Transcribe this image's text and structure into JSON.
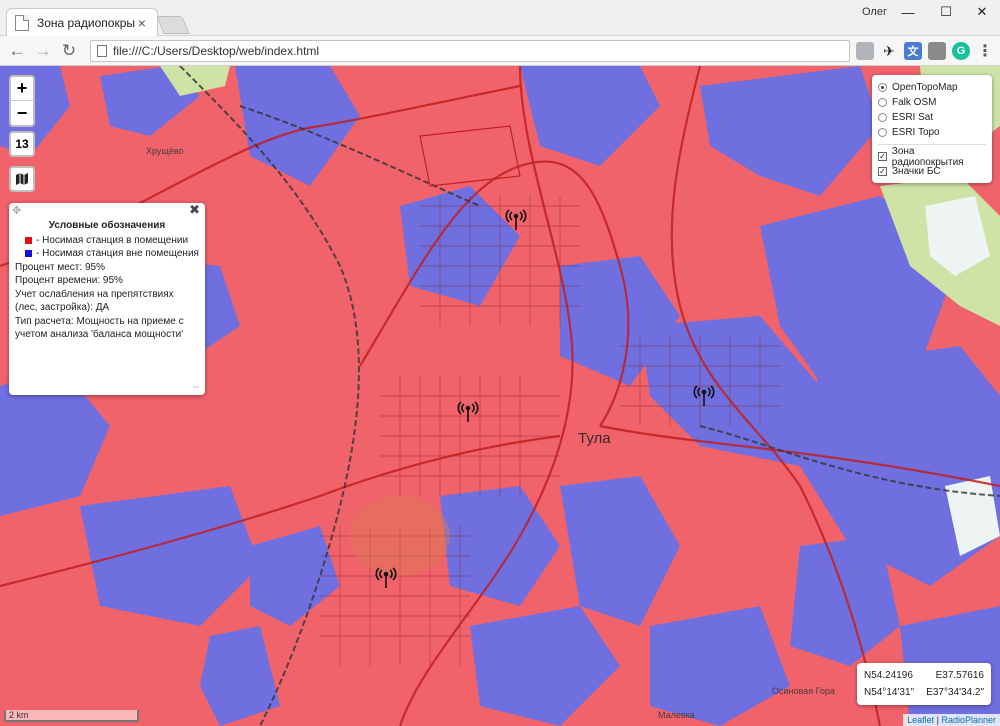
{
  "browser": {
    "tab_title": "Зона радиопокрытия",
    "tab_close": "×",
    "user_name": "Олег",
    "url": "file:///C:/Users/Desktop/web/index.html",
    "window_controls": {
      "minimize": "—",
      "maximize": "☐",
      "close": "✕"
    },
    "nav": {
      "back": "←",
      "forward": "→",
      "reload": "↻"
    },
    "extensions": [
      {
        "icon": "ghost-extension-icon",
        "color": "#9aa0a6",
        "glyph": ""
      },
      {
        "icon": "plane-extension-icon",
        "color": "#222222",
        "glyph": "✈"
      },
      {
        "icon": "translate-extension-icon",
        "color": "#4a7bd0",
        "glyph": "文"
      },
      {
        "icon": "save-extension-icon",
        "color": "#8a8a8a",
        "glyph": ""
      },
      {
        "icon": "grammar-extension-icon",
        "color": "#15c39a",
        "glyph": "G"
      }
    ],
    "menu_icon": "⋮"
  },
  "map": {
    "zoom_in": "+",
    "zoom_out": "−",
    "zoom_level": "13",
    "basemap_icon": "map-icon",
    "city_label": "Тула",
    "place_labels": [
      {
        "text": "Хрущёво"
      },
      {
        "text": "Осиновая Гора"
      },
      {
        "text": "Малевка"
      }
    ],
    "colors": {
      "coverage_indoor": "#ff0000",
      "coverage_outdoor": "#0000ff",
      "map_red": "#f0636b",
      "map_blue": "#6f6fe0"
    }
  },
  "legend": {
    "title": "Условные обозначения",
    "items": [
      {
        "label": "- Носимая станция в помещении",
        "color": "#e01010"
      },
      {
        "label": "- Носимая станция вне помещения",
        "color": "#1010e0"
      }
    ],
    "lines": [
      "Процент мест: 95%",
      "Процент времени: 95%",
      "Учет ослабления на препятствиях",
      "(лес, застройка): ДА",
      "Тип расчета: Мощность на приеме с",
      "учетом анализа 'баланса мощности'"
    ]
  },
  "layers": {
    "base": [
      {
        "label": "OpenTopoMap",
        "checked": true
      },
      {
        "label": "Falk OSM",
        "checked": false
      },
      {
        "label": "ESRI Sat",
        "checked": false
      },
      {
        "label": "ESRI Topo",
        "checked": false
      }
    ],
    "overlays": [
      {
        "label": "Зона радиопокрытия",
        "checked": true
      },
      {
        "label": "Значки БС",
        "checked": true
      }
    ]
  },
  "coords": {
    "lat_dec": "N54.24196",
    "lon_dec": "E37.57616",
    "lat_dms": "N54°14'31\"",
    "lon_dms": "E37°34'34.2\""
  },
  "scale": "2 km",
  "attribution": {
    "leaflet": "Leaflet",
    "sep": " | ",
    "radioplanner": "RadioPlanner"
  }
}
